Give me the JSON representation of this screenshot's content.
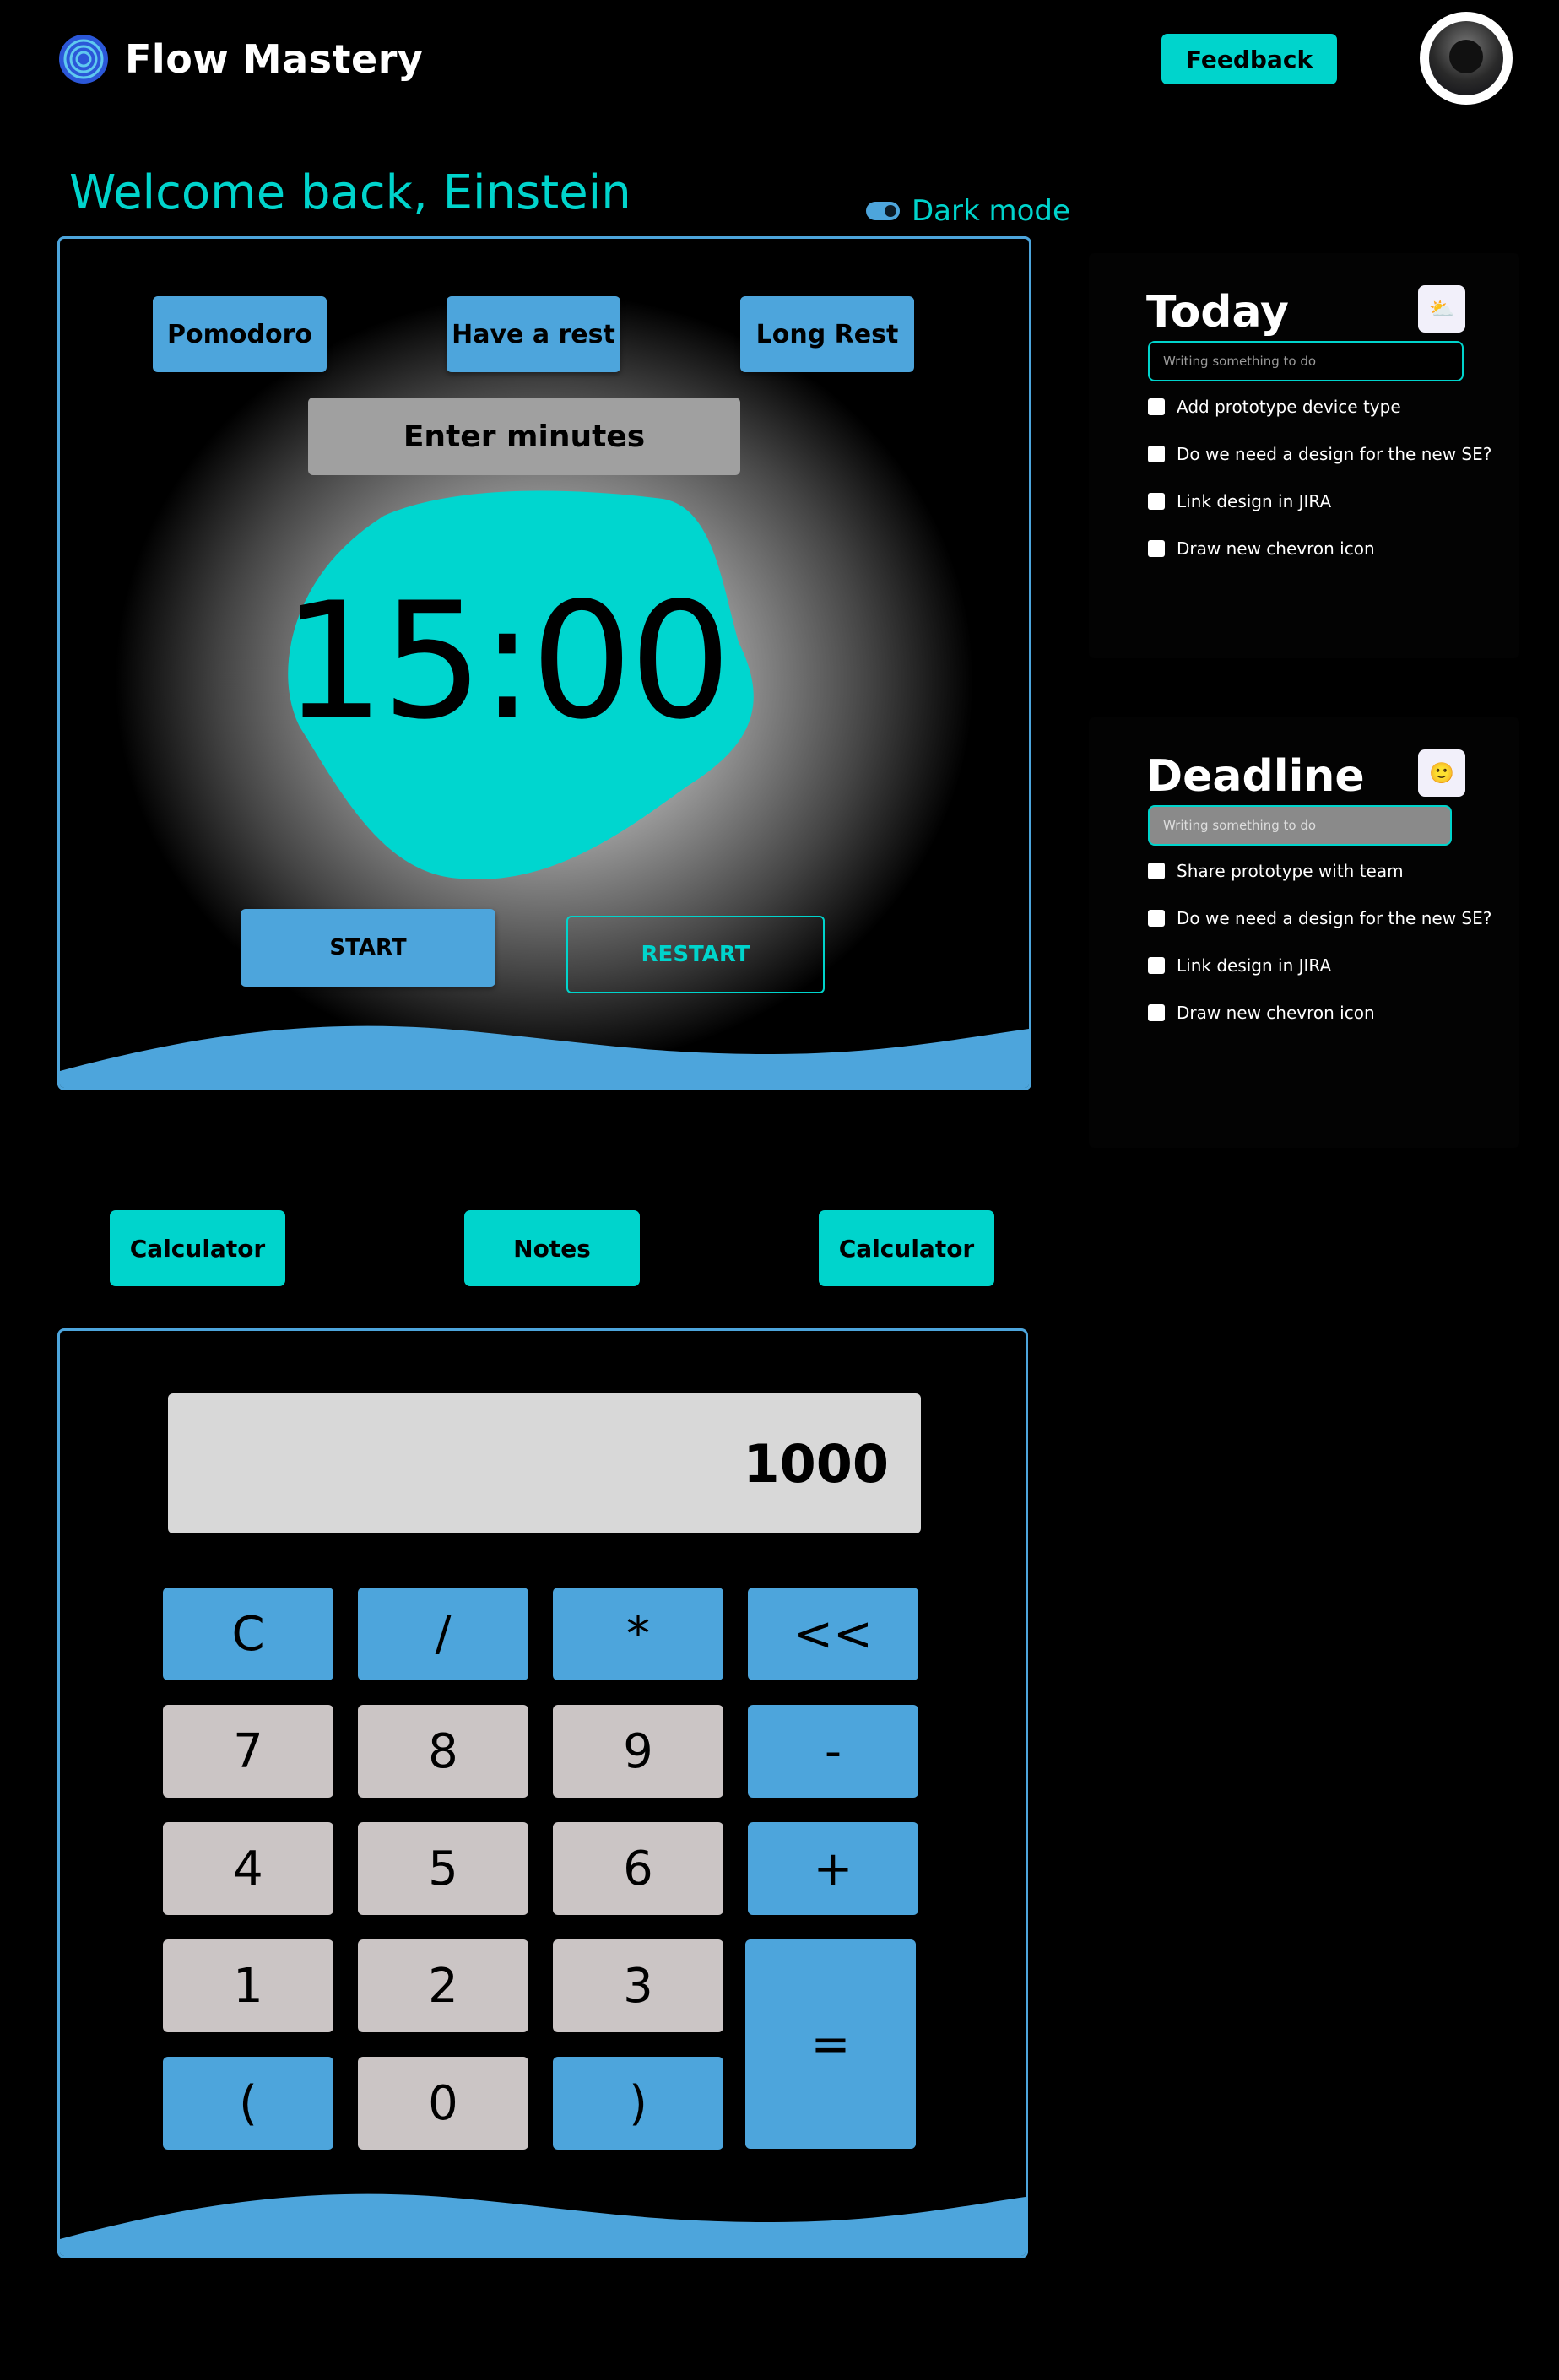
{
  "header": {
    "app_name": "Flow Mastery",
    "feedback_label": "Feedback"
  },
  "welcome": "Welcome back, Einstein",
  "dark_mode_label": "Dark mode",
  "timer": {
    "modes": [
      "Pomodoro",
      "Have a rest",
      "Long Rest"
    ],
    "minutes_placeholder": "Enter minutes",
    "display": "15:00",
    "start_label": "START",
    "restart_label": "RESTART"
  },
  "today": {
    "title": "Today",
    "icon": "sun-cloud-icon",
    "input_placeholder": "Writing something to do",
    "items": [
      "Add prototype device type",
      "Do we need a design for the new SE?",
      "Link design in JIRA",
      "Draw new chevron icon"
    ]
  },
  "deadline": {
    "title": "Deadline",
    "icon": "smiley-icon",
    "input_placeholder": "Writing something to do",
    "items": [
      "Share prototype with team",
      "Do we need a design for the new SE?",
      "Link design in JIRA",
      "Draw new chevron icon"
    ]
  },
  "tools": [
    "Calculator",
    "Notes",
    "Calculator"
  ],
  "calculator": {
    "display": "1000",
    "keys": {
      "clear": "C",
      "divide": "/",
      "multiply": "*",
      "backspace": "<<",
      "seven": "7",
      "eight": "8",
      "nine": "9",
      "minus": "-",
      "four": "4",
      "five": "5",
      "six": "6",
      "plus": "+",
      "one": "1",
      "two": "2",
      "three": "3",
      "equals": "=",
      "open_paren": "(",
      "zero": "0",
      "close_paren": ")"
    }
  },
  "colors": {
    "accent_teal": "#00d4cc",
    "accent_blue": "#4da5dc",
    "background": "#000000",
    "key_gray": "#cbc5c5"
  }
}
